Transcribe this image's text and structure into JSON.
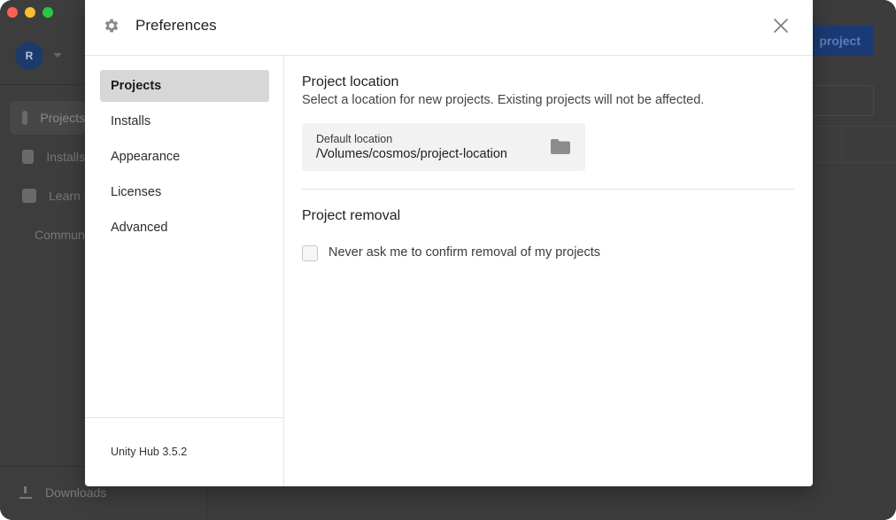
{
  "background": {
    "avatar_initial": "R",
    "nav_items": [
      {
        "label": "Projects",
        "icon": "cube-icon"
      },
      {
        "label": "Installs",
        "icon": "lock-icon"
      },
      {
        "label": "Learn",
        "icon": "graduation-cap-icon"
      },
      {
        "label": "Community",
        "icon": "people-icon"
      }
    ],
    "downloads_label": "Downloads",
    "new_project_label": "project"
  },
  "modal": {
    "title": "Preferences",
    "header_icon": "gear-icon",
    "close_icon": "close-icon",
    "sidebar": {
      "items": [
        {
          "label": "Projects",
          "active": true
        },
        {
          "label": "Installs",
          "active": false
        },
        {
          "label": "Appearance",
          "active": false
        },
        {
          "label": "Licenses",
          "active": false
        },
        {
          "label": "Advanced",
          "active": false
        }
      ],
      "version": "Unity Hub 3.5.2"
    },
    "project_location": {
      "title": "Project location",
      "description": "Select a location for new projects. Existing projects will not be affected.",
      "field_label": "Default location",
      "field_value": "/Volumes/cosmos/project-location",
      "browse_icon": "folder-icon"
    },
    "project_removal": {
      "title": "Project removal",
      "checkbox_label": "Never ask me to confirm removal of my projects",
      "checked": false
    }
  },
  "colors": {
    "active_item_bg": "#d7d7d7",
    "primary_button": "#1b3a75",
    "traffic_red": "#fe5f57",
    "traffic_yellow": "#febc2e",
    "traffic_green": "#28c840"
  }
}
